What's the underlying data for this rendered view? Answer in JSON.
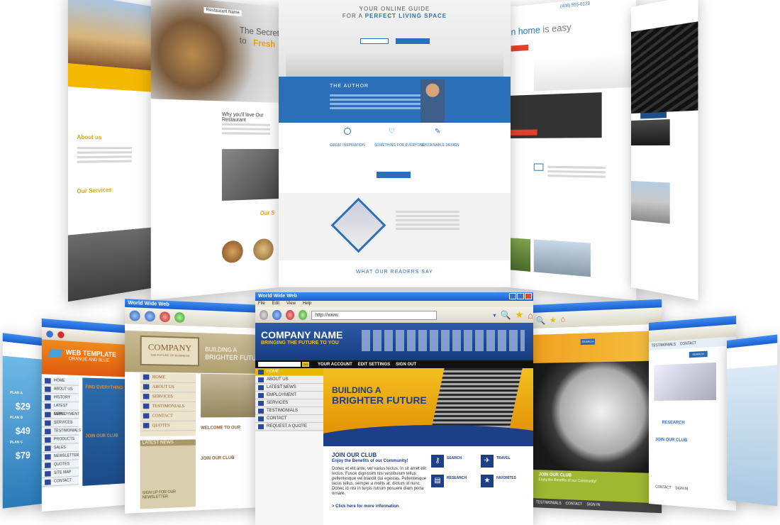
{
  "top_center": {
    "kicker": "YOUR ONLINE GUIDE",
    "headline_pre": "FOR A",
    "headline_strong": "PERFECT LIVING SPACE",
    "author_title": "THE AUTHOR",
    "features": [
      "GREAT INSPIRATION",
      "SOMETHING FOR EVERYONE",
      "SUSTAINABLE DESIGN"
    ],
    "readers_say": "WHAT OUR READERS SAY"
  },
  "top_left": {
    "about": "About us",
    "services": "Our Services"
  },
  "top_left2": {
    "logo": "Restaurant Name",
    "hero": "The Secret to",
    "hero2": "Fresh",
    "why": "Why you'll love Our Restaurant",
    "our": "Our S"
  },
  "top_right": {
    "phone": "(408) 555-0123",
    "hero_pre": "n home",
    "hero_is": "is easy"
  },
  "bottom_center": {
    "window_title": "World Wide Web",
    "menu": [
      "File",
      "Edit",
      "View",
      "Help"
    ],
    "address": "http://www.",
    "company": "COMPANY NAME",
    "tagline": "BRINGING THE FUTURE TO YOU",
    "go": "GO",
    "topnav": [
      "YOUR ACCOUNT",
      "EDIT SETTINGS",
      "SIGN OUT"
    ],
    "sidenav": [
      "HOME",
      "ABOUT US",
      "LATEST NEWS",
      "EMPLOYMENT",
      "SERVICES",
      "TESTIMONIALS",
      "CONTACT",
      "REQUEST A QUOTE"
    ],
    "hero1": "BUILDING A",
    "hero2": "BRIGHTER FUTURE",
    "club_title": "JOIN OUR CLUB",
    "club_sub": "Enjoy the Benefits of our Community!",
    "club_body": "Donec et elit ante, vel varius lectus. In sit amet elit lectus. Fusce dignissim nisi vestibulum tellus pellentesque vel blandit dui egestas. Pellentesque lacus tellus, semper a mollis at, dictum id nunc. Donec id nisi in turpis rutrum posuere diam porta ornare.",
    "club_link": "> Click here for more information",
    "icons": [
      "SEARCH",
      "TRAVEL",
      "RESEARCH",
      "FAVORITES"
    ]
  },
  "bottom_left2": {
    "window_title": "World Wide Web",
    "company": "COMPANY",
    "company_sub": "THE FUTURE OF BUSINESS",
    "building": "BUILDING A",
    "brighter": "BRIGHTER FUTU",
    "nav": [
      "HOME",
      "ABOUT US",
      "SERVICES",
      "TESTIMONIALS",
      "CONTACT",
      "QUOTES"
    ],
    "news": "LATEST NEWS",
    "welcome": "WELCOME TO OUR",
    "join": "JOIN OUR CLUB",
    "newsletter": "SIGN UP FOR OUR NEWSLETTER"
  },
  "bottom_left1": {
    "title": "WEB TEMPLATE",
    "subtitle": "ORANGE AND BLUE",
    "nav": [
      "HOME",
      "ABOUT US",
      "HISTORY",
      "LATEST NEWS",
      "EMPLOYMENT",
      "SERVICES",
      "TESTIMONIALS",
      "PRODUCTS",
      "SALES",
      "NEWSLETTER",
      "QUOTES",
      "SITE MAP",
      "CONTACT"
    ],
    "find": "FIND EVERYTHING",
    "join": "JOIN OUR CLUB"
  },
  "bottom_left0": {
    "plans": [
      "PLAN A",
      "PLAN B",
      "PLAN C"
    ],
    "prices": [
      "$29",
      "$49",
      "$79"
    ]
  },
  "bottom_right1": {
    "club": "JOIN OUR CLUB",
    "club_sub": "Enjoy the Benefits of our Community!",
    "footer": [
      "TESTIMONIALS",
      "CONTACT",
      "SIGN IN"
    ],
    "search": "SEARCH"
  },
  "bottom_right2": {
    "nav": [
      "TESTIMONIALS",
      "CONTACT"
    ],
    "search": "SEARCH",
    "research": "RESEARCH",
    "club": "JOIN OUR CLUB",
    "footer": [
      "CONTACT",
      "SIGN IN"
    ]
  }
}
